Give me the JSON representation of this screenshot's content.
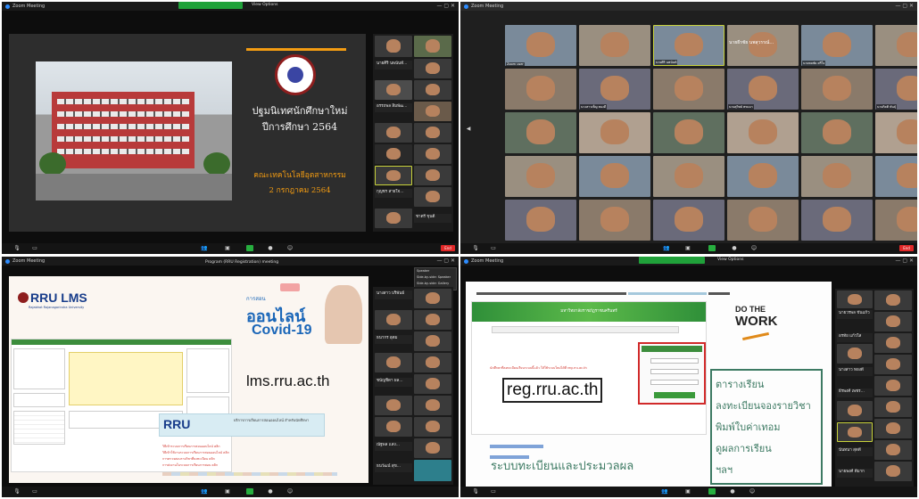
{
  "meeting_title": "Zoom Meeting",
  "q1": {
    "slide_title_line1": "ปฐมนิเทศนักศึกษาใหม่",
    "slide_title_line2": "ปีการศึกษา 2564",
    "faculty": "คณะเทคโนโลยีอุตสาหกรรม",
    "date": "2 กรกฎาคม 2564",
    "participants": [
      "นายศิริ นพนันท์...",
      "อรรถพล สิมพัฒ...",
      "กุญชร สายใจ...",
      "ชาตรี ขุนดี"
    ]
  },
  "q2": {
    "speaker_label": "นายธีรชัย นพสุวรรณ์...",
    "tiles": [
      "Zoom user",
      "นายศิริ นพนันท์",
      "นายชลชัย ศรีใจ",
      "นางสาวเพ็ญ ทองดี",
      "นายสุวิทย์ พรมมา",
      "นายกิตติ พันธุ์"
    ]
  },
  "q3": {
    "top_label": "Program (RRU Registration) meeting",
    "popup": [
      "Speaker",
      "Side-by-side: Speaker",
      "Side-by-side: Gallery"
    ],
    "lms_logo": "RRU LMS",
    "lms_sub": "Rajabhat Rajanagarindra University",
    "online_small": "การสอน",
    "online_big": "ออนไลน์",
    "covid": "Covid-19",
    "lms_url": "lms.rru.ac.th",
    "rru_logo": "RRU",
    "rru_subtitle": "บริการการเรียนการสอนออนไลน์ สำหรับนักศึกษา",
    "red_list": [
      "วิธีเข้าระบบการเรียนการสอนออนไลน์ คลิก",
      "วิธีเข้าใช้งานระบบการเรียนการสอนออนไลน์ คลิก",
      "การตรวจสอบรายวิชาที่ลงทะเบียน คลิก",
      "การส่งงานในระบบการเรียนการสอน คลิก"
    ],
    "participants": [
      "นางสาว บริพันธ์",
      "ธนากร อุดม",
      "ชนัญชิดา ผล...",
      "ณัฐพล แสง...",
      "ธนวัฒน์ สุข...",
      "ชลธิชา เอี่ยม..."
    ]
  },
  "q4": {
    "banner_text": "มหาวิทยาลัยราชภัฏราชนครินทร์",
    "red_notice": "นักศึกษาที่ลงทะเบียนเรียนระบบนี้แล้ว ให้ใช้ระบบใหม่ได้ที่ reg.rru.ac.th",
    "reg_url": "reg.rru.ac.th",
    "do_the": "DO THE",
    "work": "WORK",
    "services": [
      "ตารางเรียน",
      "ลงทะเบียนจองรายวิชา",
      "พิมพ์ใบค่าเทอม",
      "ดูผลการเรียน",
      "ฯลฯ"
    ],
    "footer": "ระบบทะเบียนและประมวลผล",
    "participants": [
      "นายวรพล ขันแก้ว",
      "อรทัย แก้วใส",
      "นางสาว ทองดี",
      "ธีรพงศ์ เพชร...",
      "นันทนา สุดดี",
      "นายพงศ์ ดีมาก"
    ]
  },
  "toolbar_labels": [
    "Unmute",
    "Start Video",
    "Participants",
    "Chat",
    "Share Screen",
    "Record",
    "Reactions"
  ],
  "end_label": "End",
  "view_options_label": "View Options",
  "colors": {
    "zoom_blue": "#2d8cff",
    "share_green": "#20a13a",
    "end_red": "#e02828",
    "accent_orange": "#f39c12"
  }
}
